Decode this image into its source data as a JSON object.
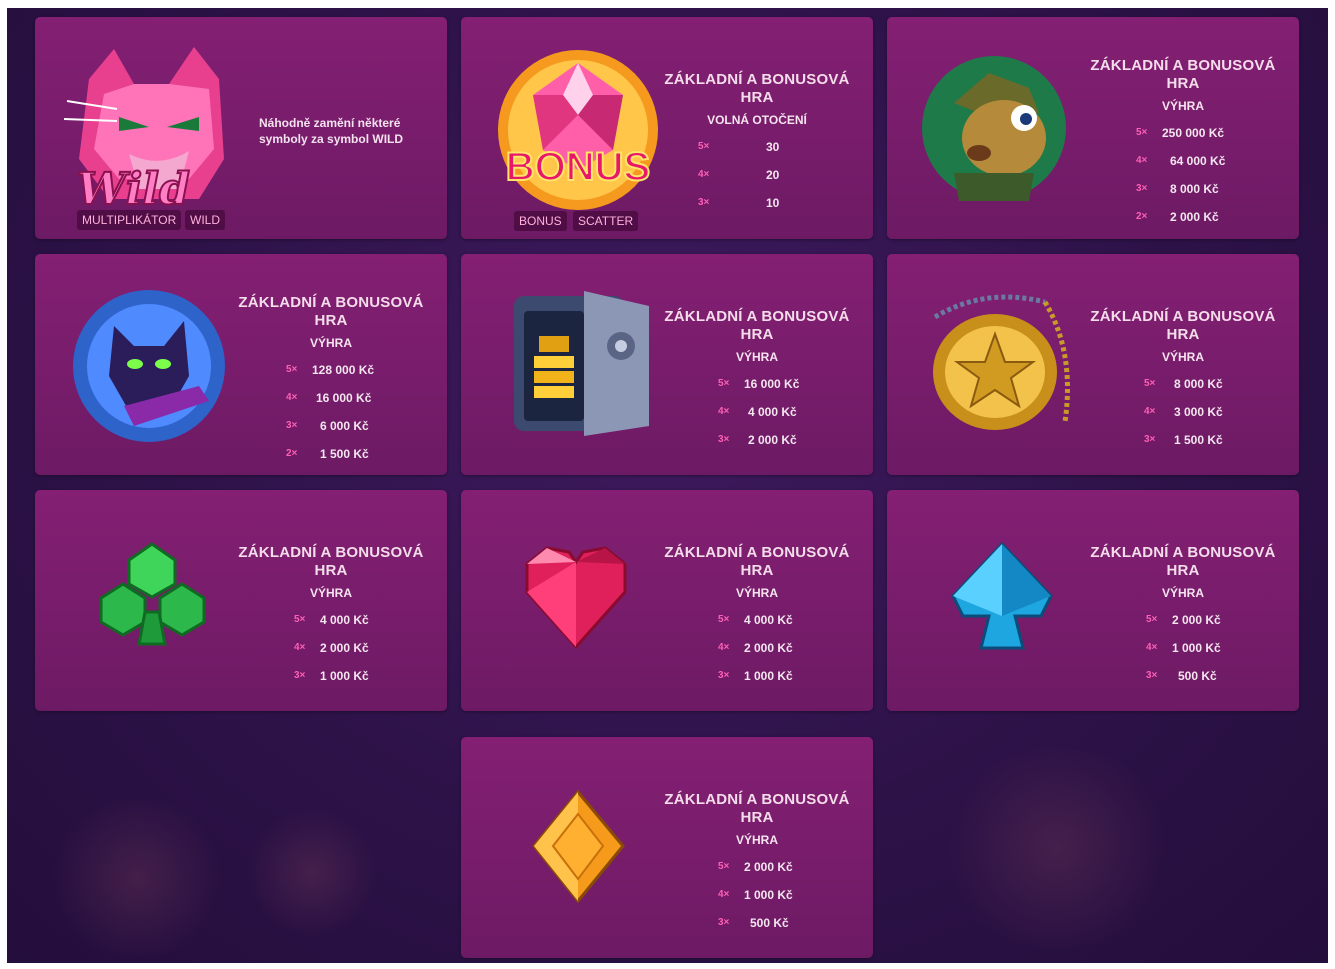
{
  "wild": {
    "logo_text": "Wild",
    "description": "Náhodně zamění některé symboly za symbol WILD",
    "tags": [
      "MULTIPLIKÁTOR",
      "WILD"
    ]
  },
  "bonus": {
    "logo_text": "BONUS",
    "title": "ZÁKLADNÍ A BONUSOVÁ HRA",
    "subtitle": "VOLNÁ OTOČENÍ",
    "tags": [
      "BONUS",
      "SCATTER"
    ],
    "rows": [
      {
        "mult": "5×",
        "value": "30"
      },
      {
        "mult": "4×",
        "value": "20"
      },
      {
        "mult": "3×",
        "value": "10"
      }
    ]
  },
  "symbols": [
    {
      "name": "dog",
      "icon": "dog-detective-icon",
      "title": "ZÁKLADNÍ A BONUSOVÁ HRA",
      "subtitle": "VÝHRA",
      "rows": [
        {
          "mult": "5×",
          "value": "250 000 Kč"
        },
        {
          "mult": "4×",
          "value": "64 000 Kč"
        },
        {
          "mult": "3×",
          "value": "8 000 Kč"
        },
        {
          "mult": "2×",
          "value": "2 000 Kč"
        }
      ]
    },
    {
      "name": "cat",
      "icon": "cat-thief-icon",
      "title": "ZÁKLADNÍ A BONUSOVÁ HRA",
      "subtitle": "VÝHRA",
      "rows": [
        {
          "mult": "5×",
          "value": "128 000 Kč"
        },
        {
          "mult": "4×",
          "value": "16 000 Kč"
        },
        {
          "mult": "3×",
          "value": "6 000 Kč"
        },
        {
          "mult": "2×",
          "value": "1 500 Kč"
        }
      ]
    },
    {
      "name": "safe",
      "icon": "safe-icon",
      "title": "ZÁKLADNÍ A BONUSOVÁ HRA",
      "subtitle": "VÝHRA",
      "rows": [
        {
          "mult": "5×",
          "value": "16 000 Kč"
        },
        {
          "mult": "4×",
          "value": "4 000 Kč"
        },
        {
          "mult": "3×",
          "value": "2 000 Kč"
        }
      ]
    },
    {
      "name": "badge",
      "icon": "police-badge-icon",
      "title": "ZÁKLADNÍ A BONUSOVÁ HRA",
      "subtitle": "VÝHRA",
      "rows": [
        {
          "mult": "5×",
          "value": "8 000 Kč"
        },
        {
          "mult": "4×",
          "value": "3 000 Kč"
        },
        {
          "mult": "3×",
          "value": "1 500 Kč"
        }
      ]
    },
    {
      "name": "club",
      "icon": "club-gem-icon",
      "title": "ZÁKLADNÍ A BONUSOVÁ HRA",
      "subtitle": "VÝHRA",
      "rows": [
        {
          "mult": "5×",
          "value": "4 000 Kč"
        },
        {
          "mult": "4×",
          "value": "2 000 Kč"
        },
        {
          "mult": "3×",
          "value": "1 000 Kč"
        }
      ]
    },
    {
      "name": "heart",
      "icon": "heart-gem-icon",
      "title": "ZÁKLADNÍ A BONUSOVÁ HRA",
      "subtitle": "VÝHRA",
      "rows": [
        {
          "mult": "5×",
          "value": "4 000 Kč"
        },
        {
          "mult": "4×",
          "value": "2 000 Kč"
        },
        {
          "mult": "3×",
          "value": "1 000 Kč"
        }
      ]
    },
    {
      "name": "spade",
      "icon": "spade-gem-icon",
      "title": "ZÁKLADNÍ A BONUSOVÁ HRA",
      "subtitle": "VÝHRA",
      "rows": [
        {
          "mult": "5×",
          "value": "2 000 Kč"
        },
        {
          "mult": "4×",
          "value": "1 000 Kč"
        },
        {
          "mult": "3×",
          "value": "500 Kč"
        }
      ]
    },
    {
      "name": "diamond",
      "icon": "diamond-gem-icon",
      "title": "ZÁKLADNÍ A BONUSOVÁ HRA",
      "subtitle": "VÝHRA",
      "rows": [
        {
          "mult": "5×",
          "value": "2 000 Kč"
        },
        {
          "mult": "4×",
          "value": "1 000 Kč"
        },
        {
          "mult": "3×",
          "value": "500 Kč"
        }
      ]
    }
  ],
  "colors": {
    "card": "#7a1d6c",
    "background": "#2d1248",
    "multiplier": "#ff5fb6"
  }
}
